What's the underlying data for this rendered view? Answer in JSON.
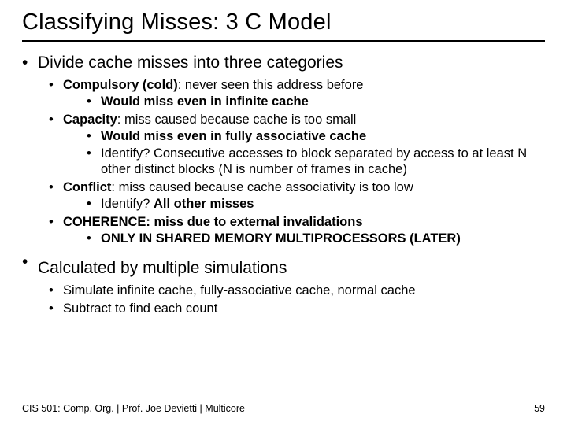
{
  "title": "Classifying Misses: 3 C Model",
  "b1": "Divide cache misses into three categories",
  "compulsory_label": "Compulsory (cold)",
  "compulsory_tail": ": never seen this address before",
  "compulsory_sub": "Would miss even in infinite cache",
  "capacity_label": "Capacity",
  "capacity_tail": ": miss caused because cache is too small",
  "capacity_sub1": "Would miss even in fully associative cache",
  "capacity_sub2": "Identify? Consecutive accesses to block separated by access to at least N other distinct blocks (N is number of frames in cache)",
  "conflict_label": "Conflict",
  "conflict_tail": ": miss caused because cache associativity is too low",
  "conflict_sub_prefix": "Identify? ",
  "conflict_sub_bold": "All other misses",
  "coherence": "COHERENCE: miss due to external invalidations",
  "coherence_sub": "ONLY IN SHARED MEMORY MULTIPROCESSORS (LATER)",
  "b2": "Calculated by multiple simulations",
  "b2_sub1": "Simulate infinite cache, fully-associative cache, normal cache",
  "b2_sub2": "Subtract to find each count",
  "footer": "CIS 501: Comp. Org.  |  Prof. Joe Devietti  |  Multicore",
  "page": "59"
}
